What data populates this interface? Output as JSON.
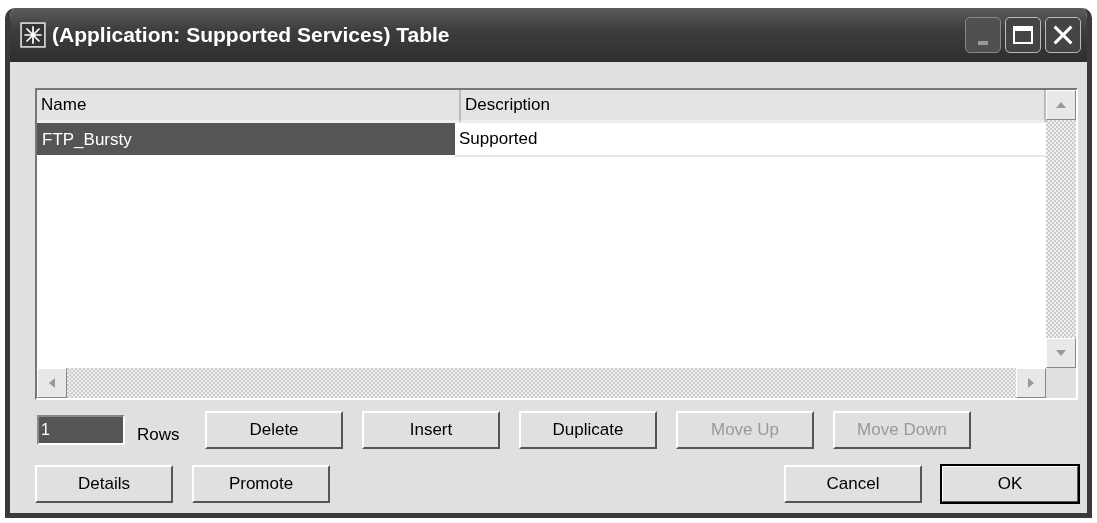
{
  "window": {
    "title": "(Application: Supported Services) Table"
  },
  "table": {
    "columns": [
      "Name",
      "Description"
    ],
    "rows": [
      {
        "cells": [
          "FTP_Bursty",
          "Supported"
        ],
        "selected": true
      }
    ]
  },
  "rows_field": {
    "value": "1",
    "label": "Rows"
  },
  "edit_buttons": [
    {
      "label": "Delete",
      "disabled": false
    },
    {
      "label": "Insert",
      "disabled": false
    },
    {
      "label": "Duplicate",
      "disabled": false
    },
    {
      "label": "Move Up",
      "disabled": true
    },
    {
      "label": "Move Down",
      "disabled": true
    }
  ],
  "left_buttons": [
    {
      "label": "Details",
      "disabled": false
    },
    {
      "label": "Promote",
      "disabled": false
    }
  ],
  "right_buttons": [
    {
      "label": "Cancel",
      "default": false
    },
    {
      "label": "OK",
      "default": true
    }
  ]
}
